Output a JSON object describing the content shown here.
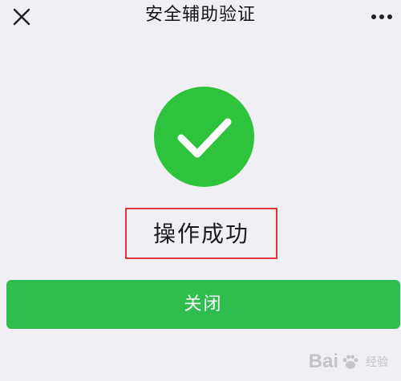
{
  "header": {
    "title": "安全辅助验证",
    "close_icon": "close-icon",
    "more_icon": "more-icon"
  },
  "result": {
    "icon": "success-check-icon",
    "icon_color": "#2ec33c",
    "message": "操作成功",
    "highlight_color": "#e0353e"
  },
  "actions": {
    "close_label": "关闭",
    "button_color": "#2fbd4d"
  },
  "watermark": {
    "text": "Bai",
    "suffix": "经验"
  }
}
